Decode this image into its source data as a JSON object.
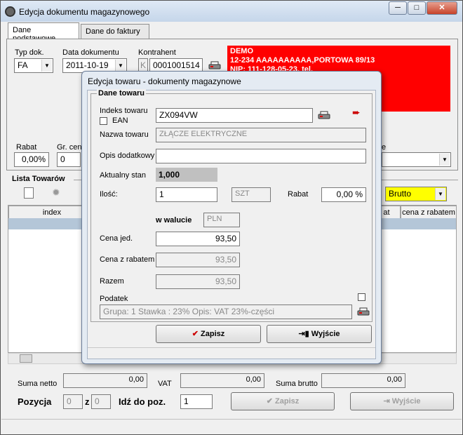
{
  "window": {
    "title": "Edycja dokumentu magazynowego",
    "min": "─",
    "max": "□",
    "close": "✕"
  },
  "tabs": [
    {
      "label": "Dane podstawowe"
    },
    {
      "label": "Dane do faktury"
    }
  ],
  "header": {
    "typ_dok_label": "Typ dok.",
    "typ_dok_value": "FA",
    "data_label": "Data dokumentu",
    "data_value": "2011-10-19",
    "kontrahent_label": "Kontrahent",
    "kontrahent_prefix": "K",
    "kontrahent_value": "0001001514",
    "red_lines": [
      "DEMO",
      "12-234 AAAAAAAAAA,PORTOWA 89/13",
      "NIP: 111-128-05-23, tel."
    ],
    "rabat_label": "Rabat",
    "rabat_value": "0,00%",
    "gr_cen_label": "Gr. cen",
    "gr_cen_value": "0",
    "e_label": "e"
  },
  "list": {
    "title": "Lista Towarów",
    "price_mode": "Brutto",
    "columns": [
      "index",
      "at",
      "cena z rabatem"
    ]
  },
  "footer": {
    "suma_netto_label": "Suma netto",
    "suma_netto_value": "0,00",
    "vat_label": "VAT",
    "vat_value": "0,00",
    "suma_brutto_label": "Suma brutto",
    "suma_brutto_value": "0,00",
    "pozycja_label": "Pozycja",
    "pozycja_value": "0",
    "z_label": "z",
    "z_value": "0",
    "idz_label": "Idź do poz.",
    "idz_value": "1",
    "zapisz_label": "Zapisz",
    "wyjscie_label": "Wyjście"
  },
  "dialog": {
    "title": "Edycja towaru - dokumenty magazynowe",
    "group_label": "Dane towaru",
    "indeks_label": "Indeks towaru",
    "indeks_value": "ZX094VW",
    "ean_label": "EAN",
    "nazwa_label": "Nazwa towaru",
    "nazwa_value": "ZŁĄCZE ELEKTRYCZNE",
    "opis_label": "Opis dodatkowy",
    "opis_value": "",
    "stan_label": "Aktualny stan",
    "stan_value": "1,000",
    "ilosc_label": "Ilość:",
    "ilosc_value": "1",
    "jm_value": "SZT",
    "rabat_label": "Rabat",
    "rabat_value": "0,00 %",
    "waluta_label": "w walucie",
    "waluta_value": "PLN",
    "cena_jed_label": "Cena jed.",
    "cena_jed_value": "93,50",
    "cena_rabat_label": "Cena z rabatem",
    "cena_rabat_value": "93,50",
    "razem_label": "Razem",
    "razem_value": "93,50",
    "podatek_label": "Podatek",
    "podatek_info": "Grupa: 1   Stawka : 23%   Opis: VAT 23%-części",
    "zapisz_label": "Zapisz",
    "wyjscie_label": "Wyjście"
  },
  "colors": {
    "red_panel": "#ff0000",
    "brutto_bg": "#ffff00",
    "grid_selected": "#b4c6d8"
  }
}
